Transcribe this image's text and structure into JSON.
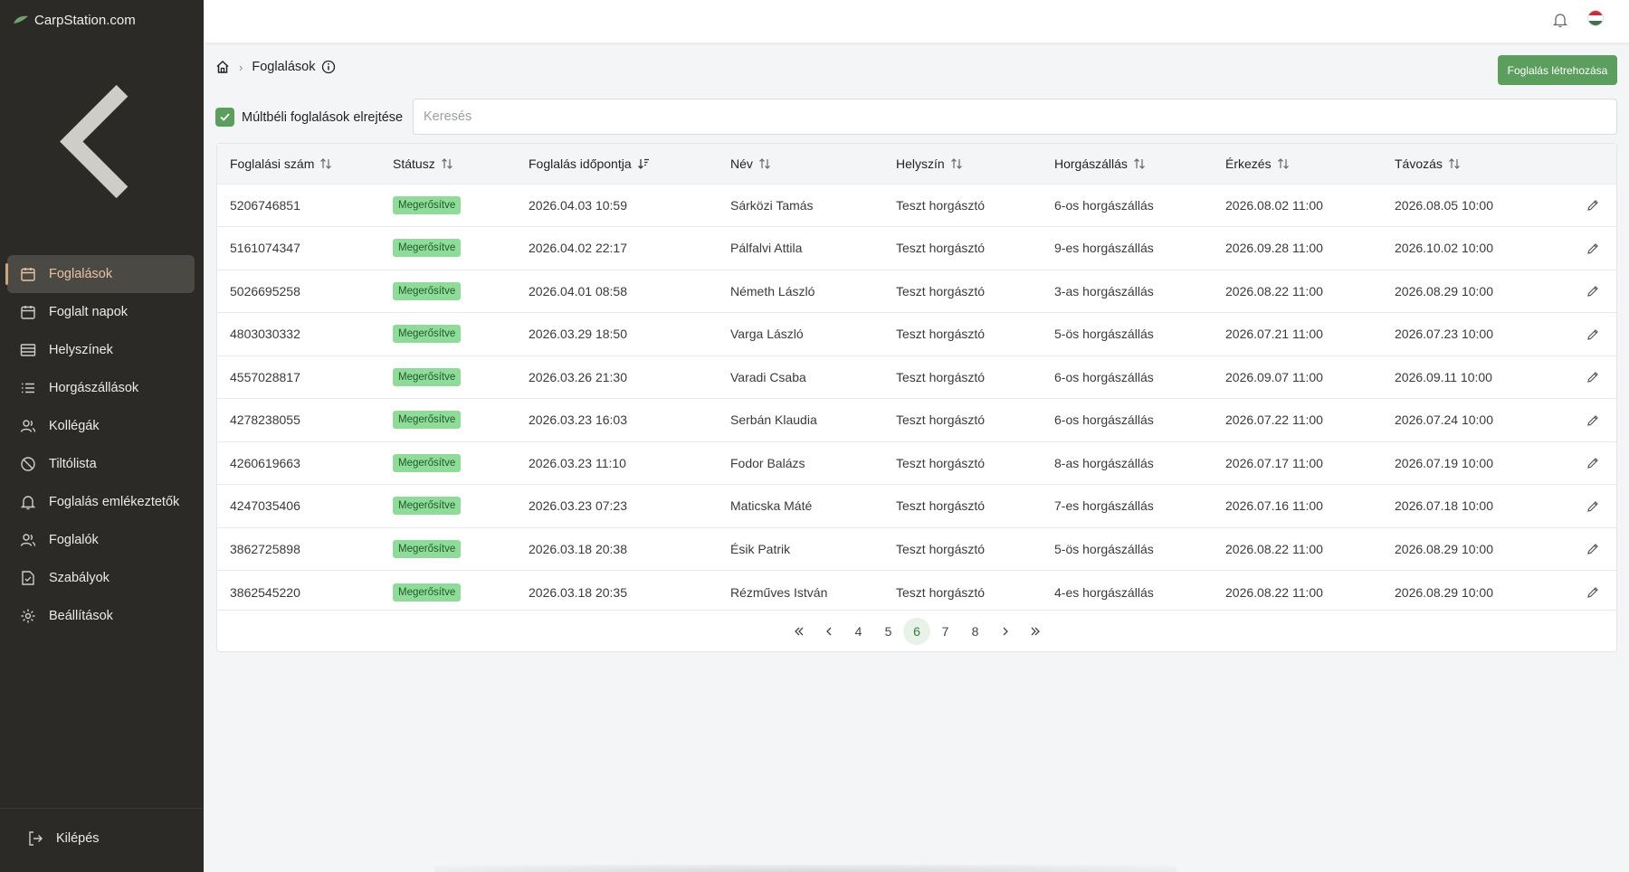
{
  "brand": {
    "name": "CarpStation.com"
  },
  "sidebar": {
    "items": [
      {
        "label": "Foglalások",
        "icon": "calendar-icon",
        "active": true
      },
      {
        "label": "Foglalt napok",
        "icon": "calendar-icon"
      },
      {
        "label": "Helyszínek",
        "icon": "table-list-icon"
      },
      {
        "label": "Horgászállások",
        "icon": "list-icon"
      },
      {
        "label": "Kollégák",
        "icon": "users-icon"
      },
      {
        "label": "Tiltólista",
        "icon": "ban-icon"
      },
      {
        "label": "Foglalás emlékeztetők",
        "icon": "bell-icon"
      },
      {
        "label": "Foglalók",
        "icon": "users-icon"
      },
      {
        "label": "Szabályok",
        "icon": "rules-icon"
      },
      {
        "label": "Beállítások",
        "icon": "gear-icon"
      }
    ],
    "logout_label": "Kilépés"
  },
  "breadcrumb": {
    "current": "Foglalások"
  },
  "actions": {
    "create_label": "Foglalás létrehozása"
  },
  "filter": {
    "hide_past_label": "Múltbéli foglalások elrejtése",
    "hide_past_checked": true
  },
  "search": {
    "placeholder": "Keresés",
    "value": ""
  },
  "table": {
    "columns": [
      "Foglalási szám",
      "Státusz",
      "Foglalás időpontja",
      "Név",
      "Helyszín",
      "Horgászállás",
      "Érkezés",
      "Távozás"
    ],
    "rows": [
      {
        "id": "5206746851",
        "status": "Megerősítve",
        "booked": "2026.04.03 10:59",
        "name": "Sárközi Tamás",
        "location": "Teszt horgásztó",
        "spot": "6-os horgászállás",
        "arrival": "2026.08.02 11:00",
        "departure": "2026.08.05 10:00"
      },
      {
        "id": "5161074347",
        "status": "Megerősítve",
        "booked": "2026.04.02 22:17",
        "name": "Pálfalvi Attila",
        "location": "Teszt horgásztó",
        "spot": "9-es horgászállás",
        "arrival": "2026.09.28 11:00",
        "departure": "2026.10.02 10:00"
      },
      {
        "id": "5026695258",
        "status": "Megerősítve",
        "booked": "2026.04.01 08:58",
        "name": "Németh László",
        "location": "Teszt horgásztó",
        "spot": "3-as horgászállás",
        "arrival": "2026.08.22 11:00",
        "departure": "2026.08.29 10:00"
      },
      {
        "id": "4803030332",
        "status": "Megerősítve",
        "booked": "2026.03.29 18:50",
        "name": "Varga László",
        "location": "Teszt horgásztó",
        "spot": "5-ös horgászállás",
        "arrival": "2026.07.21 11:00",
        "departure": "2026.07.23 10:00"
      },
      {
        "id": "4557028817",
        "status": "Megerősítve",
        "booked": "2026.03.26 21:30",
        "name": "Varadi Csaba",
        "location": "Teszt horgásztó",
        "spot": "6-os horgászállás",
        "arrival": "2026.09.07 11:00",
        "departure": "2026.09.11 10:00"
      },
      {
        "id": "4278238055",
        "status": "Megerősítve",
        "booked": "2026.03.23 16:03",
        "name": "Serbán Klaudia",
        "location": "Teszt horgásztó",
        "spot": "6-os horgászállás",
        "arrival": "2026.07.22 11:00",
        "departure": "2026.07.24 10:00"
      },
      {
        "id": "4260619663",
        "status": "Megerősítve",
        "booked": "2026.03.23 11:10",
        "name": "Fodor Balázs",
        "location": "Teszt horgásztó",
        "spot": "8-as horgászállás",
        "arrival": "2026.07.17 11:00",
        "departure": "2026.07.19 10:00"
      },
      {
        "id": "4247035406",
        "status": "Megerősítve",
        "booked": "2026.03.23 07:23",
        "name": "Maticska Máté",
        "location": "Teszt horgásztó",
        "spot": "7-es horgászállás",
        "arrival": "2026.07.16 11:00",
        "departure": "2026.07.18 10:00"
      },
      {
        "id": "3862725898",
        "status": "Megerősítve",
        "booked": "2026.03.18 20:38",
        "name": "Ésik Patrik",
        "location": "Teszt horgásztó",
        "spot": "5-ös horgászállás",
        "arrival": "2026.08.22 11:00",
        "departure": "2026.08.29 10:00"
      },
      {
        "id": "3862545220",
        "status": "Megerősítve",
        "booked": "2026.03.18 20:35",
        "name": "Rézműves István",
        "location": "Teszt horgásztó",
        "spot": "4-es horgászállás",
        "arrival": "2026.08.22 11:00",
        "departure": "2026.08.29 10:00"
      }
    ]
  },
  "pagination": {
    "pages": [
      "4",
      "5",
      "6",
      "7",
      "8"
    ],
    "current": "6"
  },
  "colors": {
    "sidebar_bg": "#2b2a27",
    "accent_green": "#5b9e5e",
    "badge_green": "#8fdc9a",
    "active_text": "#e8c5a1"
  }
}
